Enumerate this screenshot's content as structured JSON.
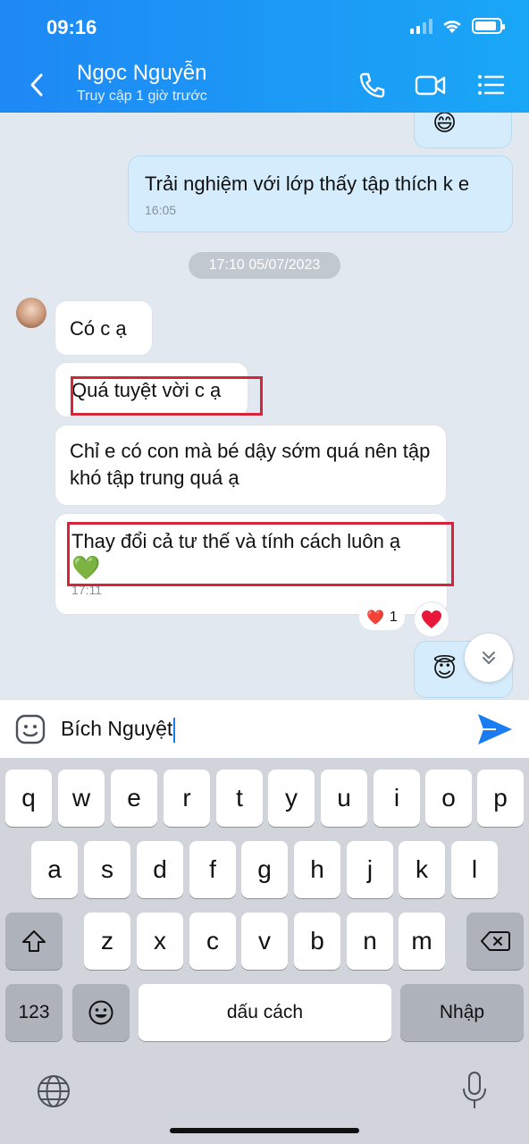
{
  "status_bar": {
    "time": "09:16"
  },
  "header": {
    "contact_name": "Ngọc Nguyễn",
    "contact_status": "Truy cập 1 giờ trước",
    "icons": [
      "back-icon",
      "phone-icon",
      "video-icon",
      "menu-icon"
    ]
  },
  "chat": {
    "messages": [
      {
        "direction": "out",
        "text": "😄"
      },
      {
        "direction": "out",
        "text": "Trải nghiệm với lớp thấy tập thích k e",
        "time": "16:05"
      },
      {
        "direction": "in",
        "text": "Có c ạ"
      },
      {
        "direction": "in",
        "text": "Quá tuyệt vời c ạ"
      },
      {
        "direction": "in",
        "text": "Chỉ e có con mà bé dậy sớm quá nên tập khó tập trung quá ạ"
      },
      {
        "direction": "in",
        "text": "Thay đổi cả tư thế và tính cách luôn ạ",
        "emoji": "💚",
        "time": "17:11"
      },
      {
        "direction": "out",
        "text": "😇"
      }
    ],
    "date_separator": "17:10 05/07/2023",
    "reaction": {
      "emoji": "❤️",
      "count": "1"
    }
  },
  "composer": {
    "value": "Bích Nguyệt"
  },
  "keyboard": {
    "row1": [
      "q",
      "w",
      "e",
      "r",
      "t",
      "y",
      "u",
      "i",
      "o",
      "p"
    ],
    "row2": [
      "a",
      "s",
      "d",
      "f",
      "g",
      "h",
      "j",
      "k",
      "l"
    ],
    "row3": [
      "z",
      "x",
      "c",
      "v",
      "b",
      "n",
      "m"
    ],
    "numbers_key": "123",
    "space_key": "dấu cách",
    "return_key": "Nhập"
  },
  "colors": {
    "header": "#1e88f5",
    "outgoing_bubble": "#d4ecfc",
    "highlight_box": "#d6243a",
    "send": "#1a7cf0"
  }
}
